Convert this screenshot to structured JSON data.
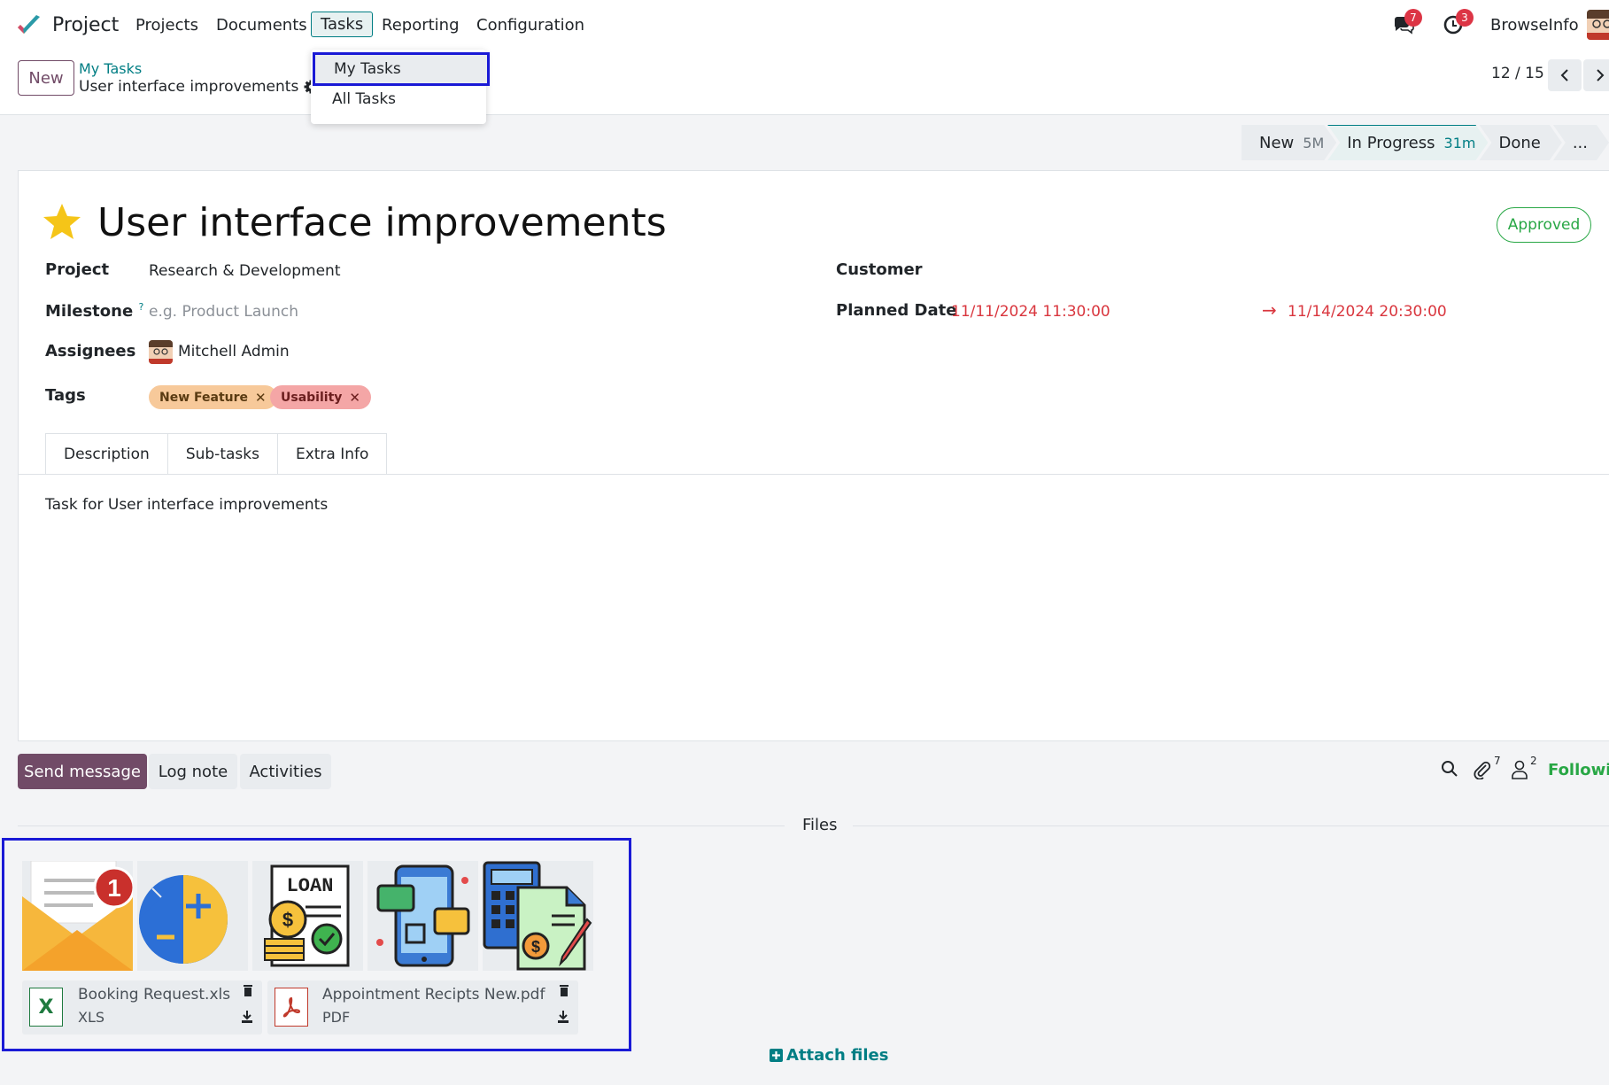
{
  "navbar": {
    "app_name": "Project",
    "menus": [
      "Projects",
      "Documents",
      "Tasks",
      "Reporting",
      "Configuration"
    ],
    "messages_count": "7",
    "activities_count": "3",
    "company": "BrowseInfo"
  },
  "control": {
    "new_label": "New",
    "breadcrumb_parent": "My Tasks",
    "breadcrumb_current": "User interface improvements",
    "pager": "12 / 15"
  },
  "dropdown": {
    "items": [
      "My Tasks",
      "All Tasks"
    ]
  },
  "stages": [
    {
      "name": "New",
      "duration": "5M"
    },
    {
      "name": "In Progress",
      "duration": "31m"
    },
    {
      "name": "Done",
      "duration": ""
    },
    {
      "name": "...",
      "duration": ""
    }
  ],
  "form": {
    "title": "User interface improvements",
    "status": "Approved",
    "project_label": "Project",
    "project_value": "Research & Development",
    "milestone_label": "Milestone",
    "milestone_help": "?",
    "milestone_placeholder": "e.g. Product Launch",
    "assignees_label": "Assignees",
    "assignee": "Mitchell Admin",
    "tags_label": "Tags",
    "tags": [
      {
        "label": "New Feature",
        "color": "#f7c99a"
      },
      {
        "label": "Usability",
        "color": "#f4a6a6"
      }
    ],
    "customer_label": "Customer",
    "planned_label": "Planned Date",
    "planned_start": "11/11/2024 11:30:00",
    "planned_end": "11/14/2024 20:30:00",
    "arrow": "→"
  },
  "tabs": [
    "Description",
    "Sub-tasks",
    "Extra Info"
  ],
  "description_text": "Task for User interface improvements",
  "chatter": {
    "send_message": "Send message",
    "log_note": "Log note",
    "activities": "Activities",
    "attachments_count": "7",
    "followers_count": "2",
    "following": "Followin",
    "files_label": "Files",
    "attach_files": "Attach files"
  },
  "attachments": {
    "images": [
      "envelope-notification-icon",
      "zoom-plus-minus-icon",
      "loan-document-icon",
      "mobile-chat-icon",
      "calculator-invoice-icon"
    ],
    "notification_count": "1",
    "loan_text": "LOAN",
    "files": [
      {
        "name": "Booking Request.xls",
        "ext": "XLS",
        "icon": "X"
      },
      {
        "name": "Appointment Recipts New.pdf",
        "ext": "PDF",
        "icon": "pdf"
      }
    ]
  },
  "colors": {
    "brand": "#714b67",
    "accent": "#017e84",
    "highlight": "#1a1ad6",
    "danger": "#d9363e",
    "success": "#28a745"
  }
}
